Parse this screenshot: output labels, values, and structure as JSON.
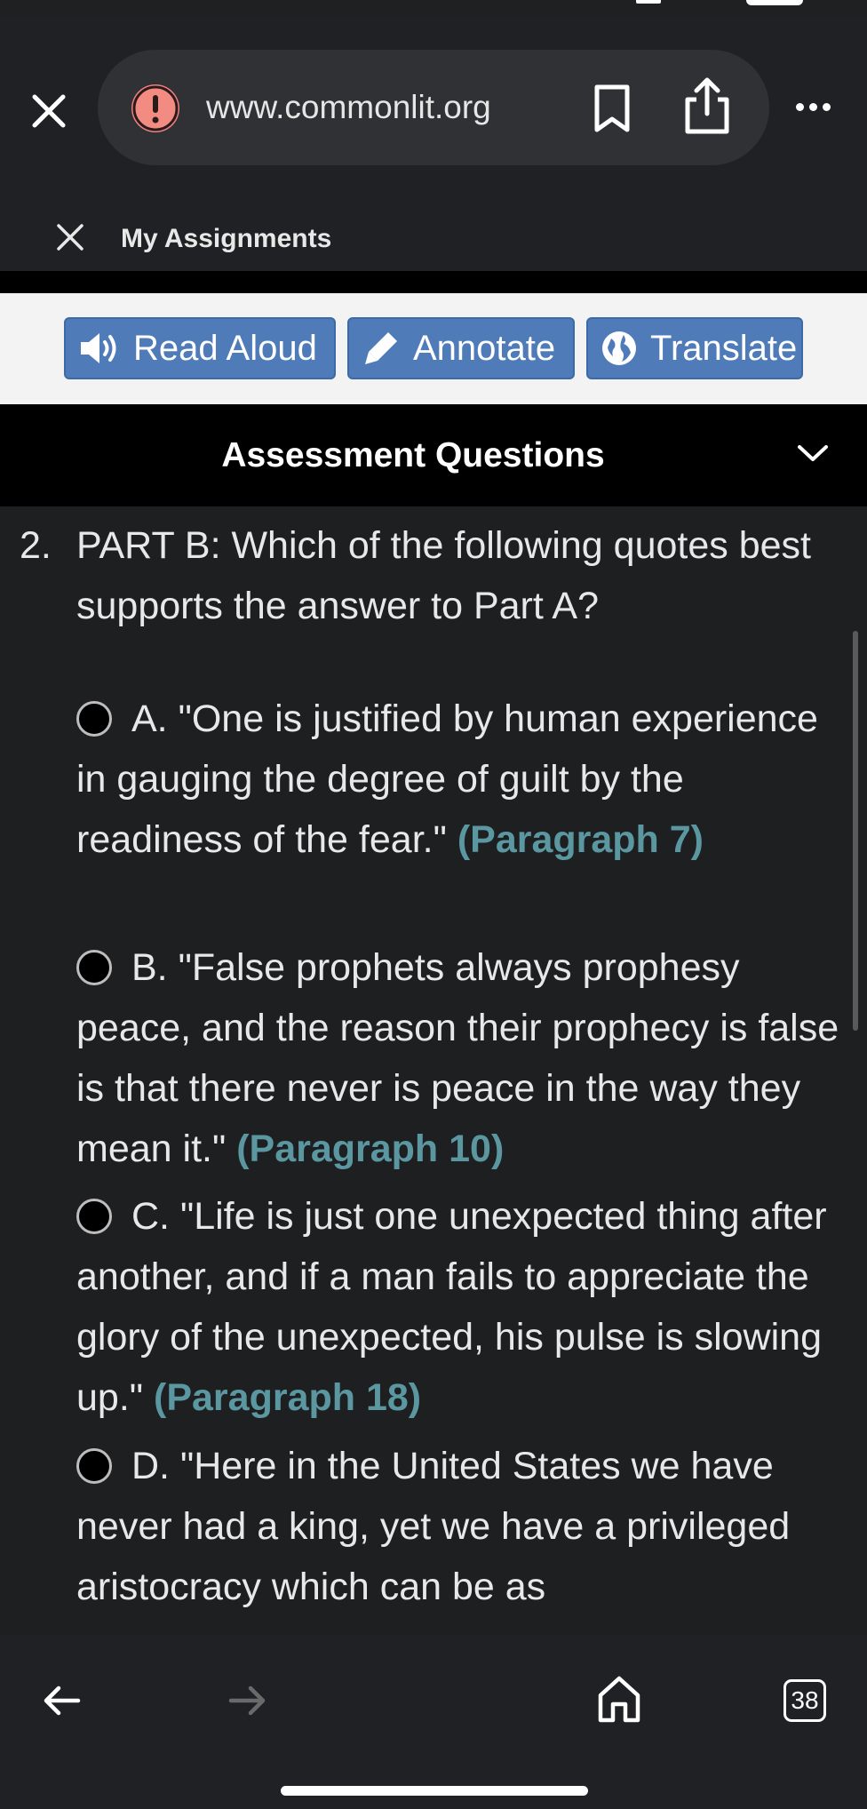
{
  "browser": {
    "url": "www.commonlit.org",
    "tab_title": "My Assignments",
    "tab_count": "38"
  },
  "toolbar": {
    "read_aloud": "Read Aloud",
    "annotate": "Annotate",
    "translate": "Translate",
    "button_color": "#4f7cb9"
  },
  "section": {
    "title": "Assessment Questions"
  },
  "question": {
    "number": "2.",
    "text": "PART B: Which of the following quotes best supports the answer to Part A?",
    "options": [
      {
        "letter": "A.",
        "quote": "\"One is justified by human experience in gauging the degree of guilt by the readiness of the fear.\"",
        "citation": "(Paragraph 7)"
      },
      {
        "letter": "B.",
        "quote": "\"False prophets always prophesy peace, and the reason their prophecy is false is that there never is peace in the way they mean it.\"",
        "citation": "(Paragraph 10)"
      },
      {
        "letter": "C.",
        "quote": "\"Life is just one unexpected thing after another, and if a man fails to appreciate the glory of the unexpected, his pulse is slowing up.\"",
        "citation": "(Paragraph 18)"
      },
      {
        "letter": "D.",
        "quote": "\"Here in the United States we have never had a king, yet we have a privileged aristocracy which can be as",
        "citation": ""
      }
    ]
  },
  "colors": {
    "citation": "#5b97a1",
    "background": "#1e1f21"
  }
}
